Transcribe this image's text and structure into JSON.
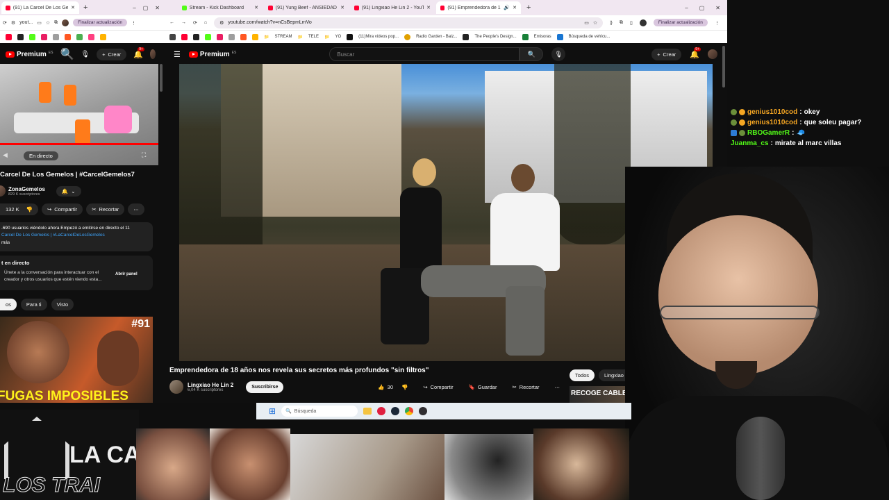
{
  "left_browser": {
    "tab_title": "(91) La Carcel De Los Gemelos",
    "url": "yout...",
    "update_label": "Finalizar actualización",
    "yt_logo": "Premium",
    "yt_logo_region": "ES",
    "create_label": "Crear",
    "notif_count": "9+",
    "live_label": "En directo",
    "video_title": "Carcel De Los Gemelos | #CarcelGemelos7",
    "channel": "ZonaGemelos",
    "subs": "829 K suscriptores",
    "likes": "132 K",
    "share": "Compartir",
    "clip": "Recortar",
    "desc_line1": ".690 usuarios viéndolo ahora  Empezó a emitirse en directo el 11",
    "desc_line2": "Carcel De Los Gemelos | #LaCarcelDeLosGemelos",
    "desc_more": "más",
    "chat_title": "t en directo",
    "chat_msg": "Únete a la conversación para interactuar con el creador y otros usuarios que estén viendo esta...",
    "chat_open": "Abrir panel",
    "chips": [
      "os",
      "Para ti",
      "Visto"
    ],
    "thumb_badge": "#91",
    "thumb_text": "FUGAS IMPOSIBLES"
  },
  "right_browser": {
    "tabs": [
      {
        "label": "Stream - Kick Dashboard",
        "color": "#53fc18"
      },
      {
        "label": "(91) Yung Beef - ANSIEDAD - Yo",
        "color": "#ff0033"
      },
      {
        "label": "(91) Lingxiao He Lin 2 - YouTube",
        "color": "#ff0033"
      },
      {
        "label": "(91) Emprendedora de 18 a",
        "color": "#ff0033"
      }
    ],
    "url": "youtube.com/watch?v=nCsBepmLmVo",
    "update_label": "Finalizar actualización",
    "bookmarks": [
      "STREAM",
      "TELE",
      "YO",
      "(11)Mira vídeos pop...",
      "Radio Garden - Balz...",
      "The People's Design...",
      "Emisoras",
      "Búsqueda de vehícu..."
    ],
    "yt_logo": "Premium",
    "yt_logo_region": "ES",
    "search_placeholder": "Buscar",
    "create_label": "Crear",
    "notif_count": "9+",
    "video_title": "Emprendedora de 18 años nos revela sus secretos más profundos \"sin filtros\"",
    "channel": "Lingxiao He Lin 2",
    "subs": "6,04 K suscriptores",
    "subscribe": "Suscribirse",
    "likes": "30",
    "share": "Compartir",
    "save": "Guardar",
    "clip": "Recortar",
    "chip_all": "Todos",
    "chip_channel": "Lingxiao He Lin",
    "rec_thumb_text": "RECOGE CABLE?"
  },
  "chat": [
    {
      "user": "genius1010cod",
      "msg": "okey",
      "color": "#f5a623"
    },
    {
      "user": "genius1010cod",
      "msg": "que soleu pagar?",
      "color": "#f5a623"
    },
    {
      "user": "RBOGamerR",
      "msg": "🧢",
      "color": "#53fc18"
    },
    {
      "user": "Juanma_cs",
      "msg": "mirate al marc villas",
      "color": "#53fc18"
    }
  ],
  "taskbar": {
    "search_placeholder": "Búsqueda"
  },
  "overlay_logo_text_1": "LA CA",
  "overlay_logo_text_2": "LOS TRAI"
}
